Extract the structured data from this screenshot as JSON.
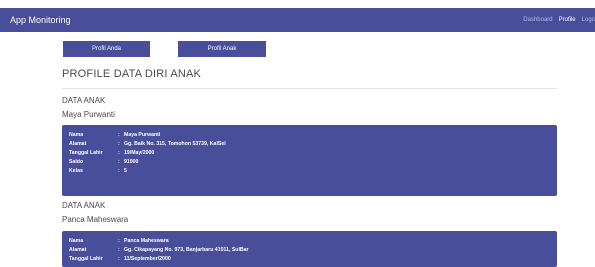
{
  "navbar": {
    "brand": "App Monitoring",
    "links": [
      {
        "label": "Dashboard",
        "active": false
      },
      {
        "label": "Profile",
        "active": true
      },
      {
        "label": "Logo",
        "active": false
      }
    ]
  },
  "tabs": [
    "Profil Anda",
    "Profil Anak"
  ],
  "page_title": "PROFILE DATA DIRI ANAK",
  "children": [
    {
      "section_label": "DATA ANAK",
      "name": "Maya Purwanti",
      "details": [
        {
          "key": "Nama",
          "sep": ":",
          "value": "Maya Purwanti"
        },
        {
          "key": "Alamat",
          "sep": ":",
          "value": "Gg. Baik No. 315, Tomohon 53739, KalSel"
        },
        {
          "key": "Tanggal Lahir",
          "sep": ":",
          "value": "19/May/2000"
        },
        {
          "key": "Saldo",
          "sep": ":",
          "value": "91000"
        },
        {
          "key": "Kelas",
          "sep": ":",
          "value": "5"
        }
      ]
    },
    {
      "section_label": "DATA ANAK",
      "name": "Panca Maheswara",
      "details": [
        {
          "key": "Nama",
          "sep": ":",
          "value": "Panca Maheswara"
        },
        {
          "key": "Alamat",
          "sep": ":",
          "value": "Gg. Cikapayang No. 973, Banjarbaru 41011, SulBar"
        },
        {
          "key": "Tanggal Lahir",
          "sep": ":",
          "value": "11/September/2000"
        }
      ]
    }
  ]
}
